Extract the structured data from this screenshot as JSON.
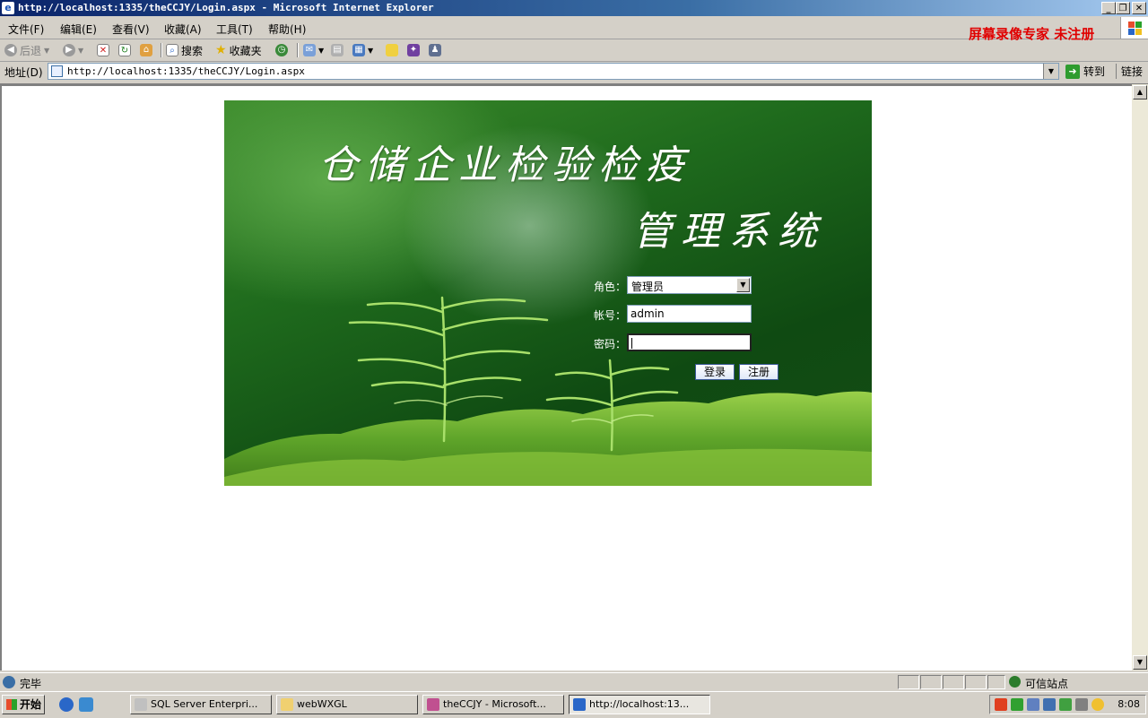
{
  "window": {
    "title": "http://localhost:1335/theCCJY/Login.aspx - Microsoft Internet Explorer",
    "minimize": "_",
    "restore": "❐",
    "close": "✕"
  },
  "menu": {
    "items": [
      "文件(F)",
      "编辑(E)",
      "查看(V)",
      "收藏(A)",
      "工具(T)",
      "帮助(H)"
    ],
    "watermark": "屏幕录像专家 未注册"
  },
  "toolbar": {
    "back": "后退",
    "search": "搜索",
    "favorites": "收藏夹"
  },
  "address": {
    "label": "地址(D)",
    "url": "http://localhost:1335/theCCJY/Login.aspx",
    "go": "转到",
    "links": "链接"
  },
  "page": {
    "title_line1": "仓储企业检验检疫",
    "title_line2": "管理系统",
    "role_label": "角色：",
    "role_value": "管理员",
    "account_label": "帐号：",
    "account_value": "admin",
    "password_label": "密码：",
    "password_value": "",
    "login_button": "登录",
    "register_button": "注册"
  },
  "status": {
    "text": "完毕",
    "zone": "可信站点"
  },
  "taskbar": {
    "start": "开始",
    "tasks": [
      "SQL Server Enterpri...",
      "webWXGL",
      "theCCJY - Microsoft...",
      "http://localhost:13..."
    ],
    "clock": "8:08"
  },
  "colors": {
    "titlebar": "#0a246a",
    "watermark": "#e00000",
    "banner_green": "#1f6b1d"
  }
}
